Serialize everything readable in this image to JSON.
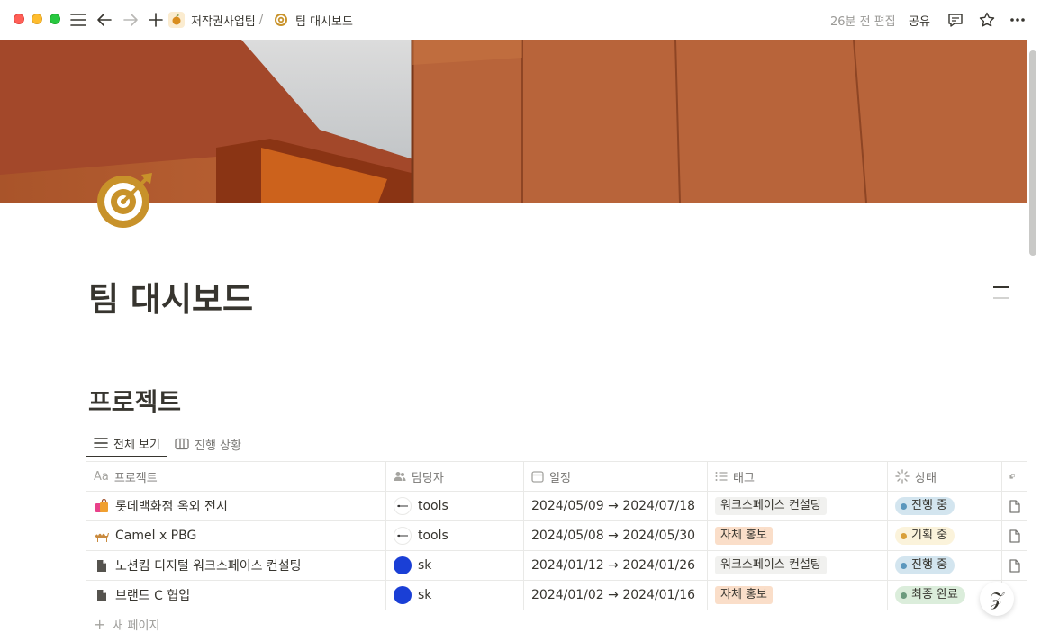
{
  "topbar": {
    "breadcrumb": [
      {
        "label": "저작권사업팀",
        "sep": "/",
        "icon": "apple-icon"
      },
      {
        "label": "팀 대시보드",
        "icon": "target-icon"
      }
    ],
    "edited": "26분 전 편집",
    "share_label": "공유"
  },
  "page": {
    "title": "팀 대시보드",
    "section_heading": "프로젝트"
  },
  "views": [
    {
      "label": "전체 보기",
      "icon": "list-icon",
      "active": true
    },
    {
      "label": "진행 상황",
      "icon": "board-icon",
      "active": false
    }
  ],
  "table": {
    "columns": [
      {
        "label": "프로젝트",
        "icon": "text-icon"
      },
      {
        "label": "담당자",
        "icon": "people-icon"
      },
      {
        "label": "일정",
        "icon": "calendar-icon"
      },
      {
        "label": "태그",
        "icon": "list-icon"
      },
      {
        "label": "상태",
        "icon": "status-icon"
      }
    ],
    "rows": [
      {
        "name": "롯데백화점 옥외 전시",
        "icon": "shopping-bags-icon",
        "owner": "tools",
        "schedule": "2024/05/09 → 2024/07/18",
        "tag": "워크스페이스 컨설팅",
        "status": "진행 중"
      },
      {
        "name": "Camel x PBG",
        "icon": "camel-icon",
        "owner": "tools",
        "schedule": "2024/05/08 → 2024/05/30",
        "tag": "자체 홍보",
        "status": "기획 중"
      },
      {
        "name": "노션킴 디지털 워크스페이스 컨설팅",
        "icon": "document-icon",
        "owner": "sk",
        "schedule": "2024/01/12 → 2024/01/26",
        "tag": "워크스페이스 컨설팅",
        "status": "진행 중"
      },
      {
        "name": "브랜드 C 협업",
        "icon": "document-icon",
        "owner": "sk",
        "schedule": "2024/01/02 → 2024/01/16",
        "tag": "자체 홍보",
        "status": "최종 완료"
      }
    ],
    "new_page_label": "새 페이지"
  },
  "colors": {
    "tag_consulting_bg": "#f1f1ef",
    "tag_promo_bg": "#fadec9",
    "status_progress_bg": "#d3e5ef",
    "status_progress_dot": "#5b97bd",
    "status_planning_bg": "#fbf3db",
    "status_planning_dot": "#d9a03a",
    "status_done_bg": "#dbeddb",
    "status_done_dot": "#6c9b7d"
  }
}
